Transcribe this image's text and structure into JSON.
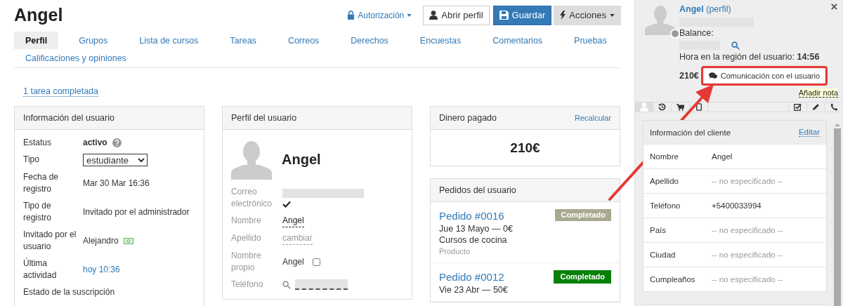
{
  "header": {
    "title": "Angel",
    "auth_link": "Autorización",
    "buttons": [
      {
        "kind": "outline",
        "label": "Abrir perfil"
      },
      {
        "kind": "primary",
        "label": "Guardar"
      },
      {
        "kind": "dropdown",
        "label": "Acciones"
      }
    ]
  },
  "tabs": [
    {
      "label": "Perfil",
      "selected": true
    },
    {
      "label": "Grupos",
      "selected": false
    },
    {
      "label": "Lista de cursos",
      "selected": false
    },
    {
      "label": "Tareas",
      "selected": false
    },
    {
      "label": "Correos",
      "selected": false
    },
    {
      "label": "Derechos",
      "selected": false
    },
    {
      "label": "Encuestas",
      "selected": false
    },
    {
      "label": "Comentarios",
      "selected": false
    },
    {
      "label": "Pruebas",
      "selected": false
    },
    {
      "label": "Calificaciones y opiniones",
      "selected": false
    }
  ],
  "task_link": "1 tarea completada",
  "user_info": {
    "title": "Información del usuario",
    "rows": [
      {
        "label": "Estatus",
        "kind": "status",
        "value": "activo"
      },
      {
        "label": "Tipo",
        "kind": "select",
        "value": "estudiante"
      },
      {
        "label": "Fecha de registro",
        "kind": "text",
        "value": "Mar 30 Mar 16:36"
      },
      {
        "label": "Tipo de registro",
        "kind": "text",
        "value": "Invitado por el administrador"
      },
      {
        "label": "Invitado por el usuario",
        "kind": "user",
        "value": "Alejandro"
      },
      {
        "label": "Última actividad",
        "kind": "link",
        "value": "hoy 10:36"
      },
      {
        "label": "Estado de la suscripción",
        "kind": "heading"
      }
    ]
  },
  "profile": {
    "title": "Perfil del usuario",
    "name": "Angel",
    "fields": [
      {
        "label": "Correo electrónico",
        "kind": "hidden_verified"
      },
      {
        "label": "Nombre",
        "kind": "editable",
        "value": "Angel"
      },
      {
        "label": "Apellido",
        "kind": "placeholder_editable",
        "value": "cambiar"
      },
      {
        "label": "Nombre propio",
        "kind": "checkbox",
        "value": "Angel",
        "checked": false
      },
      {
        "label": "Teléfono",
        "kind": "hidden_search"
      }
    ]
  },
  "paid": {
    "title": "Dinero pagado",
    "action": "Recalcular",
    "amount": "210€"
  },
  "orders": {
    "title": "Pedidos del usuario",
    "items": [
      {
        "title": "Pedido #0016",
        "line": "Jue 13 Mayo — 0€",
        "product": "Cursos de cocina",
        "type": "Producto",
        "status": "Completado",
        "kind": "muted"
      },
      {
        "title": "Pedido #0012",
        "line": "Vie 23 Abr — 50€",
        "status": "Completado",
        "kind": "success"
      }
    ]
  },
  "side": {
    "name": "Angel",
    "profile_link": "(perfil)",
    "balance_label": "Balance:",
    "time_label": "Hora en la región del usuario:",
    "time": "14:56",
    "amount": "210€",
    "chat_button": "Comunicación con el usuario",
    "note_link": "Añadir nota",
    "tabs": [
      {
        "kind": "user",
        "selected": true
      },
      {
        "kind": "history",
        "selected": false
      },
      {
        "kind": "cart",
        "selected": false
      },
      {
        "kind": "tablet",
        "selected": false
      }
    ],
    "client": {
      "title": "Información del cliente",
      "action": "Editar",
      "rows": [
        {
          "label": "Nombre",
          "value": "Angel",
          "specified": true
        },
        {
          "label": "Apellido",
          "value": "-- no especificado --",
          "specified": false
        },
        {
          "label": "Teléfono",
          "value": "+5400033994",
          "specified": true
        },
        {
          "label": "País",
          "value": "-- no especificado --",
          "specified": false
        },
        {
          "label": "Ciudad",
          "value": "-- no especificado --",
          "specified": false
        },
        {
          "label": "Cumpleaños",
          "value": "-- no especificado --",
          "specified": false
        }
      ]
    }
  },
  "annotation": {
    "highlight_box": true,
    "arrow": true
  }
}
